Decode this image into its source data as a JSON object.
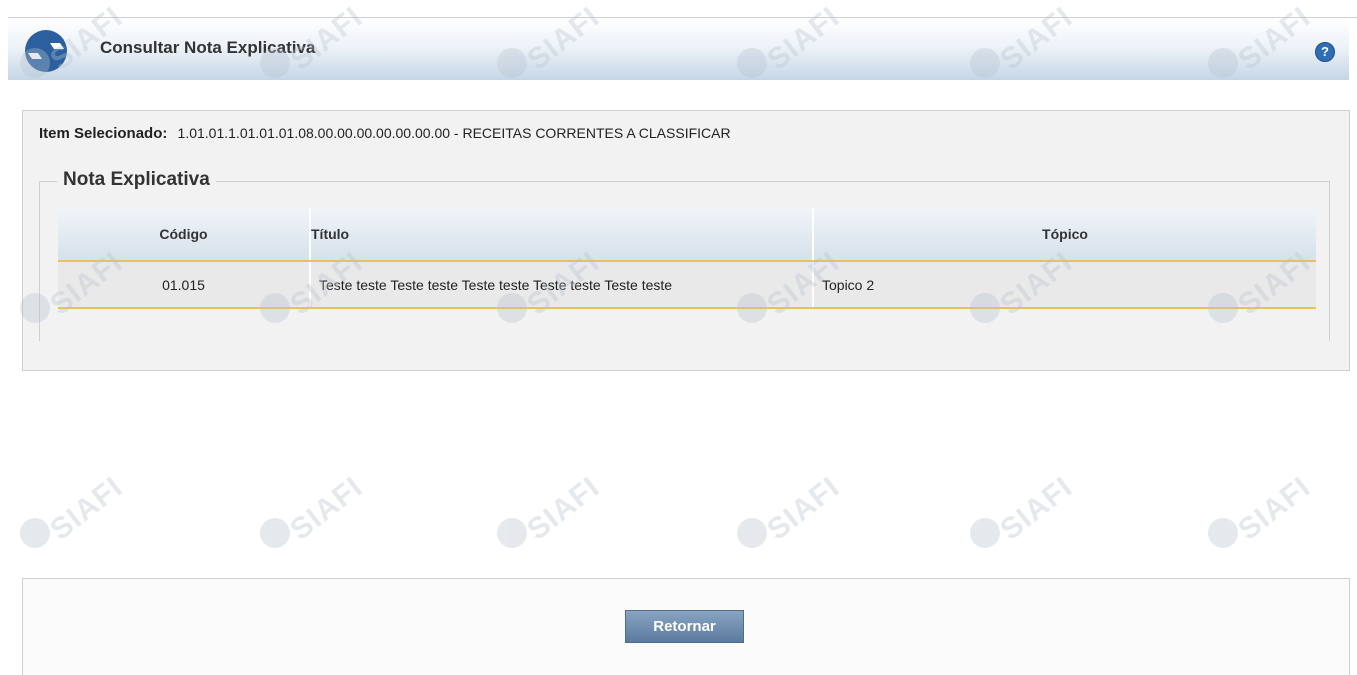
{
  "page": {
    "title": "Consultar Nota Explicativa",
    "help_label": "?"
  },
  "selected_item": {
    "label": "Item Selecionado:",
    "value": "1.01.01.1.01.01.01.08.00.00.00.00.00.00.00 - RECEITAS CORRENTES A CLASSIFICAR"
  },
  "section": {
    "legend": "Nota Explicativa"
  },
  "table": {
    "headers": [
      "Código",
      "Título",
      "Tópico"
    ],
    "rows": [
      [
        "01.015",
        "Teste teste Teste teste Teste teste Teste teste Teste teste",
        "Topico 2"
      ]
    ]
  },
  "actions": {
    "return_label": "Retornar"
  },
  "watermark": "SIAFI",
  "colors": {
    "header_gradient_end": "#c6d6e6",
    "row_separator": "#e7c15a",
    "button": "#5a7a9e",
    "help_icon": "#2f6db5"
  }
}
